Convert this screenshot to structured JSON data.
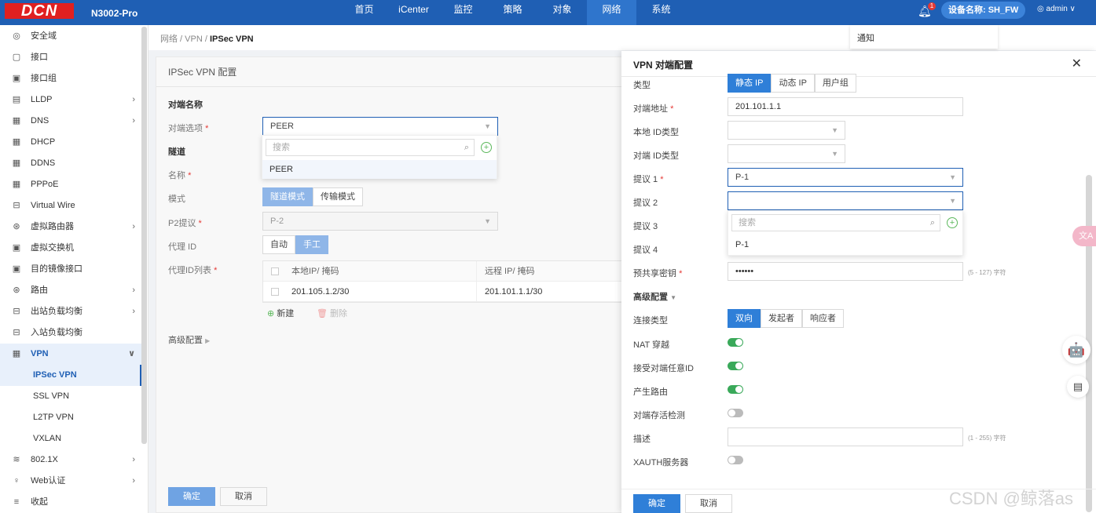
{
  "topbar": {
    "logo": "DCN",
    "model": "N3002-Pro",
    "nav": [
      "首页",
      "iCenter",
      "监控",
      "策略",
      "对象",
      "网络",
      "系统"
    ],
    "bell_badge": "1",
    "device_label": "设备名称: SH_FW",
    "user": "admin ∨"
  },
  "notice": {
    "label": "通知"
  },
  "sidebar": {
    "items": [
      {
        "label": "安全域",
        "icon": "◎"
      },
      {
        "label": "接口",
        "icon": "▢"
      },
      {
        "label": "接口组",
        "icon": "▣"
      },
      {
        "label": "LLDP",
        "icon": "▤",
        "arrow": "›"
      },
      {
        "label": "DNS",
        "icon": "▦",
        "arrow": "›"
      },
      {
        "label": "DHCP",
        "icon": "▦"
      },
      {
        "label": "DDNS",
        "icon": "▦"
      },
      {
        "label": "PPPoE",
        "icon": "▦"
      },
      {
        "label": "Virtual Wire",
        "icon": "⊟"
      },
      {
        "label": "虚拟路由器",
        "icon": "⊛",
        "arrow": "›"
      },
      {
        "label": "虚拟交换机",
        "icon": "▣"
      },
      {
        "label": "目的镜像接口",
        "icon": "▣"
      },
      {
        "label": "路由",
        "icon": "⊛",
        "arrow": "›"
      },
      {
        "label": "出站负载均衡",
        "icon": "⊟",
        "arrow": "›"
      },
      {
        "label": "入站负载均衡",
        "icon": "⊟"
      },
      {
        "label": "VPN",
        "icon": "▦",
        "arrow": "∨"
      },
      {
        "label": "IPSec VPN"
      },
      {
        "label": "SSL VPN"
      },
      {
        "label": "L2TP VPN"
      },
      {
        "label": "VXLAN"
      },
      {
        "label": "802.1X",
        "icon": "≋",
        "arrow": "›"
      },
      {
        "label": "Web认证",
        "icon": "♀",
        "arrow": "›"
      },
      {
        "label": "收起",
        "icon": "≡"
      }
    ]
  },
  "breadcrumb": {
    "path": "网络 / VPN / ",
    "current": "IPSec VPN"
  },
  "main": {
    "title": "IPSec VPN 配置",
    "peer_section": "对端名称",
    "peer_option_label": "对端选项",
    "peer_value": "PEER",
    "search_placeholder": "搜索",
    "peer_dropdown_option": "PEER",
    "tunnel_section": "隧道",
    "name_label": "名称",
    "mode_label": "模式",
    "mode_options": [
      "隧道模式",
      "传输模式"
    ],
    "p2_label": "P2提议",
    "p2_value": "P-2",
    "proxy_label": "代理 ID",
    "proxy_options": [
      "自动",
      "手工"
    ],
    "proxy_list_label": "代理ID列表",
    "table_headers": [
      "本地IP/ 掩码",
      "远程 IP/ 掩码"
    ],
    "table_rows": [
      [
        "201.105.1.2/30",
        "201.101.1.1/30"
      ]
    ],
    "add_label": "新建",
    "delete_label": "删除",
    "advanced_label": "高级配置",
    "ok_label": "确定",
    "cancel_label": "取消"
  },
  "drawer": {
    "title": "VPN 对端配置",
    "type_label": "类型",
    "type_options": [
      "静态 IP",
      "动态 IP",
      "用户组"
    ],
    "peer_addr_label": "对端地址",
    "peer_addr_value": "201.101.1.1",
    "local_id_label": "本地 ID类型",
    "peer_id_label": "对端 ID类型",
    "proposal1_label": "提议 1",
    "proposal1_value": "P-1",
    "proposal2_label": "提议 2",
    "proposal3_label": "提议 3",
    "proposal4_label": "提议 4",
    "search_placeholder": "搜索",
    "dropdown_option": "P-1",
    "psk_label": "预共享密钥",
    "psk_value": "••••••",
    "psk_hint": "(5 - 127) 字符",
    "advanced_label": "高级配置",
    "conn_type_label": "连接类型",
    "conn_type_options": [
      "双向",
      "发起者",
      "响应者"
    ],
    "nat_label": "NAT 穿越",
    "accept_any_label": "接受对端任意ID",
    "gen_route_label": "产生路由",
    "dpd_label": "对端存活检测",
    "desc_label": "描述",
    "desc_hint": "(1 - 255) 字符",
    "xauth_label": "XAUTH服务器",
    "ok_label": "确定",
    "cancel_label": "取消"
  },
  "floats": {
    "pink_label": "文A",
    "robot": "🤖",
    "doc": "▤"
  },
  "watermark": "CSDN @鲸落as"
}
